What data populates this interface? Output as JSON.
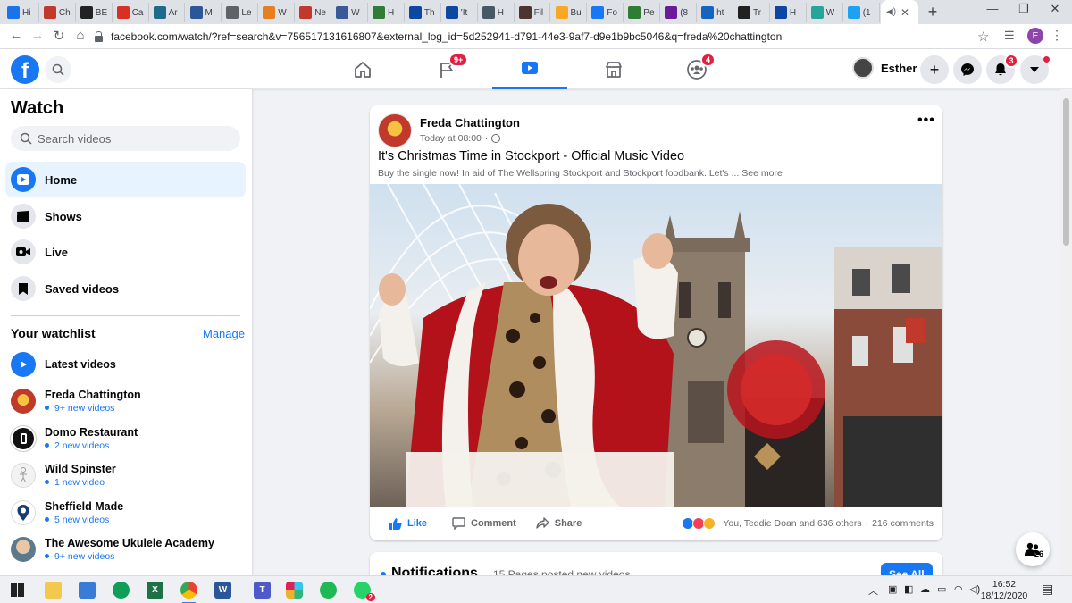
{
  "browser": {
    "tabs": [
      {
        "label": "Hi",
        "color": "#1a73e8",
        "glyph": ""
      },
      {
        "label": "Ch",
        "color": "#c0392b",
        "glyph": ""
      },
      {
        "label": "BE",
        "color": "#222222",
        "glyph": ""
      },
      {
        "label": "Ca",
        "color": "#d93025",
        "glyph": ""
      },
      {
        "label": "Ar",
        "color": "#1e6a8d",
        "glyph": ""
      },
      {
        "label": "M",
        "color": "#2b579a",
        "glyph": ""
      },
      {
        "label": "Le",
        "color": "#5f6368",
        "glyph": ""
      },
      {
        "label": "W",
        "color": "#e67e22",
        "glyph": ""
      },
      {
        "label": "Ne",
        "color": "#c0392b",
        "glyph": ""
      },
      {
        "label": "W",
        "color": "#3b5998",
        "glyph": ""
      },
      {
        "label": "H",
        "color": "#2e7d32",
        "glyph": ""
      },
      {
        "label": "Th",
        "color": "#0d47a1",
        "glyph": ""
      },
      {
        "label": "'It",
        "color": "#0d47a1",
        "glyph": ""
      },
      {
        "label": "H",
        "color": "#455a64",
        "glyph": ""
      },
      {
        "label": "Fil",
        "color": "#4e342e",
        "glyph": ""
      },
      {
        "label": "Bu",
        "color": "#f9a825",
        "glyph": ""
      },
      {
        "label": "Fo",
        "color": "#1877f2",
        "glyph": ""
      },
      {
        "label": "Pe",
        "color": "#2e7d32",
        "glyph": ""
      },
      {
        "label": "(8",
        "color": "#6a1b9a",
        "glyph": ""
      },
      {
        "label": "ht",
        "color": "#1565c0",
        "glyph": ""
      },
      {
        "label": "Tr",
        "color": "#212121",
        "glyph": ""
      },
      {
        "label": "H",
        "color": "#0d47a1",
        "glyph": ""
      },
      {
        "label": "W",
        "color": "#26a69a",
        "glyph": ""
      },
      {
        "label": "(1",
        "color": "#1da1f2",
        "glyph": ""
      }
    ],
    "url": "facebook.com/watch/?ref=search&v=756517131616807&external_log_id=5d252941-d791-44e3-9af7-d9e1b9bc5046&q=freda%20chattington",
    "profile_initial": "E",
    "back_icon": "arrow-left-icon",
    "forward_icon": "arrow-right-icon",
    "reload_icon": "reload-icon",
    "home_icon": "home-icon"
  },
  "fbnav": {
    "user_name": "Esther",
    "groups_badge": "9+",
    "gaming_badge": "4",
    "notifications_badge": "3",
    "accent": "#1877f2"
  },
  "sidebar": {
    "title": "Watch",
    "search_placeholder": "Search videos",
    "items": [
      {
        "label": "Home",
        "icon": "play-icon"
      },
      {
        "label": "Shows",
        "icon": "clapper-icon"
      },
      {
        "label": "Live",
        "icon": "live-camera-icon"
      },
      {
        "label": "Saved videos",
        "icon": "bookmark-icon"
      }
    ],
    "watchlist_title": "Your watchlist",
    "watchlist_manage": "Manage",
    "latest_videos": "Latest videos",
    "watchlist": [
      {
        "name": "Freda Chattington",
        "sub": "9+ new videos",
        "color": "#c0392b"
      },
      {
        "name": "Domo Restaurant",
        "sub": "2 new videos",
        "color": "#111111"
      },
      {
        "name": "Wild Spinster",
        "sub": "1 new video",
        "color": "#eeeeee"
      },
      {
        "name": "Sheffield Made",
        "sub": "5 new videos",
        "color": "#1a3c6e"
      },
      {
        "name": "The Awesome Ukulele Academy",
        "sub": "9+ new videos",
        "color": "#5d7a8c"
      }
    ]
  },
  "post": {
    "author": "Freda Chattington",
    "time": "Today at 08:00",
    "title": "It's Christmas Time in Stockport - Official Music Video",
    "description": "Buy the single now! In aid of The Wellspring Stockport and Stockport foodbank. Let's ... See more",
    "like_label": "Like",
    "comment_label": "Comment",
    "share_label": "Share",
    "reactions_text": "You, Teddie Doan and 636 others",
    "comments_count": "216 comments"
  },
  "notifications": {
    "title": "Notifications",
    "subtitle": "15 Pages posted new videos",
    "see_all": "See All"
  },
  "contacts_count": "26",
  "taskbar": {
    "time": "16:52",
    "date": "18/12/2020",
    "whatsapp_badge": "2"
  }
}
